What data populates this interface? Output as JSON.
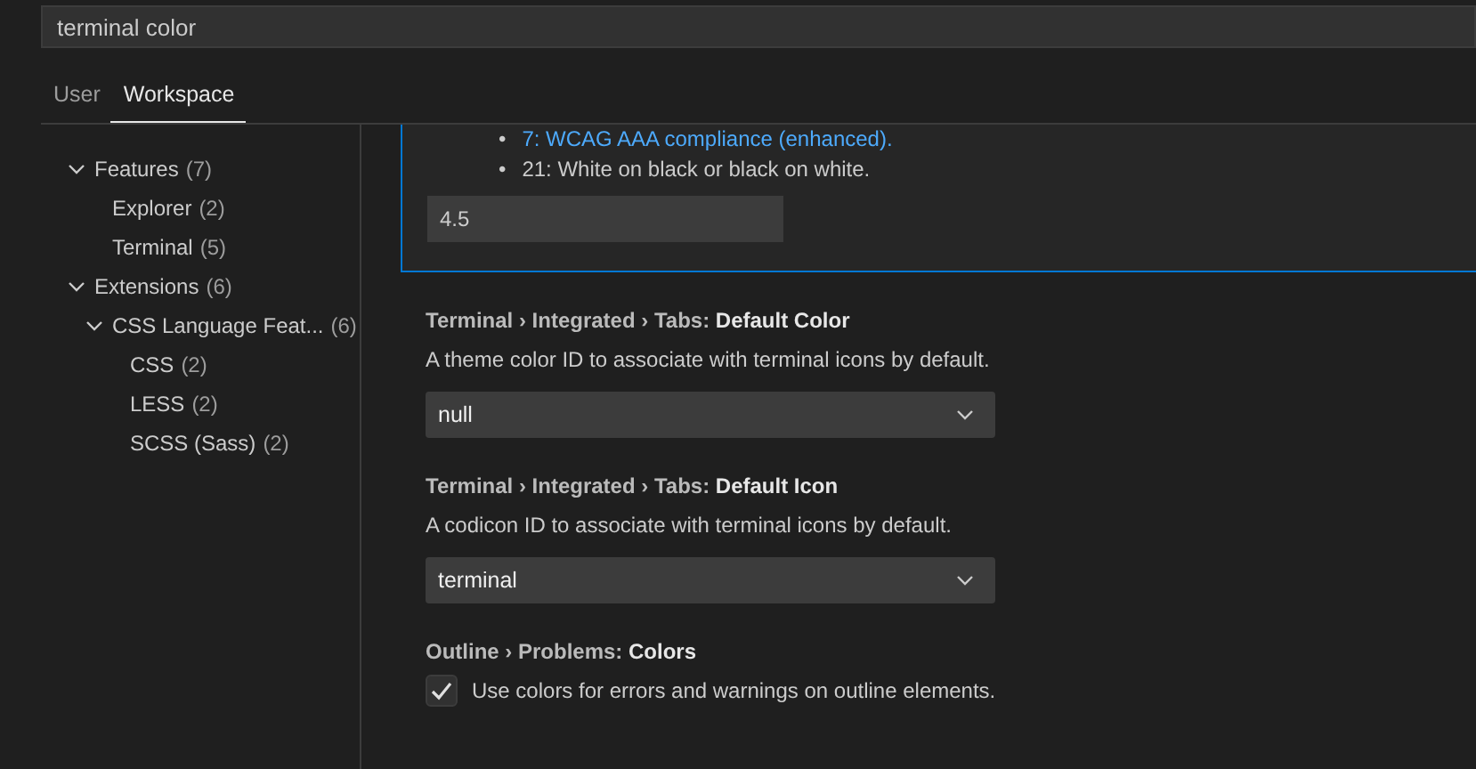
{
  "search": {
    "value": "terminal color"
  },
  "tabs": [
    {
      "label": "User",
      "selected": false
    },
    {
      "label": "Workspace",
      "selected": true
    }
  ],
  "tree": [
    {
      "label": "Features",
      "count": "(7)",
      "expanded": true,
      "children": [
        {
          "label": "Explorer",
          "count": "(2)"
        },
        {
          "label": "Terminal",
          "count": "(5)"
        }
      ]
    },
    {
      "label": "Extensions",
      "count": "(6)",
      "expanded": true,
      "children": [
        {
          "label": "CSS Language Feat...",
          "count": "(6)",
          "expanded": true,
          "children": [
            {
              "label": "CSS",
              "count": "(2)"
            },
            {
              "label": "LESS",
              "count": "(2)"
            },
            {
              "label": "SCSS (Sass)",
              "count": "(2)"
            }
          ]
        }
      ]
    }
  ],
  "settings": [
    {
      "kind": "number",
      "focused": true,
      "bullets": [
        {
          "marker": "•",
          "text": "7: WCAG AAA compliance (enhanced).",
          "link": true
        },
        {
          "marker": "•",
          "text": "21: White on black or black on white.",
          "link": false
        }
      ],
      "value": "4.5"
    },
    {
      "kind": "dropdown",
      "focused": false,
      "category": "Terminal › Integrated › Tabs: ",
      "name": "Default Color",
      "description": "A theme color ID to associate with terminal icons by default.",
      "value": "null"
    },
    {
      "kind": "dropdown",
      "focused": false,
      "category": "Terminal › Integrated › Tabs: ",
      "name": "Default Icon",
      "description": "A codicon ID to associate with terminal icons by default.",
      "value": "terminal"
    },
    {
      "kind": "checkbox",
      "focused": false,
      "category": "Outline › Problems: ",
      "name": "Colors",
      "description": "Use colors for errors and warnings on outline elements.",
      "checked": true
    }
  ]
}
